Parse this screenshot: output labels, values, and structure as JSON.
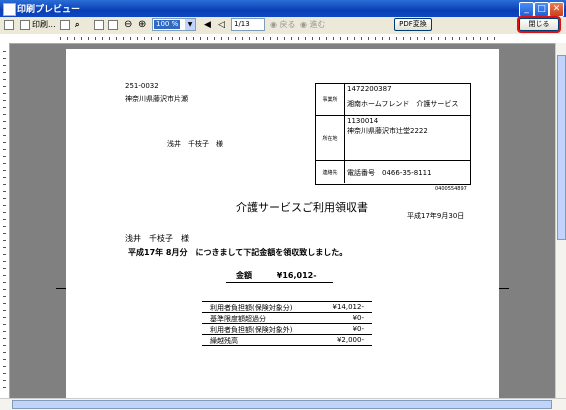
{
  "window": {
    "title": "印刷プレビュー"
  },
  "toolbar": {
    "print_label": "印刷...",
    "zoom_value": "100 %",
    "page_value": "1/13",
    "prev_label": "戻る",
    "next_label": "進む",
    "pdf_label": "PDF変換",
    "close_label": "閉じる"
  },
  "doc": {
    "postal": "251-0032",
    "address": "神奈川県藤沢市片瀬",
    "recipient": "浅井　千枝子　様",
    "office_label": "事業所",
    "office_code": "1472200387",
    "office_name": "湘南ホームフレンド　介護サービス",
    "location_label": "所在地",
    "location_postal": "1130014",
    "location_address": "神奈川県藤沢市辻堂2222",
    "contact_label": "連絡先",
    "contact_value": "電話番号　0466-35-8111",
    "doc_no": "0400554897",
    "heading": "介護サービスご利用領収書",
    "date": "平成17年9月30日",
    "customer": "浅井　千枝子　様",
    "statement": "平成17年 8月分　につきまして下記金額を領収致しました。",
    "total_label": "金額",
    "total_value": "¥16,012-",
    "rows": [
      {
        "label": "利用者負担額(保険対象分)",
        "value": "¥14,012-"
      },
      {
        "label": "基準限度額超過分",
        "value": "¥0-"
      },
      {
        "label": "利用者負担額(保険対象外)",
        "value": "¥0-"
      },
      {
        "label": "繰越残高",
        "value": "¥2,000-"
      }
    ]
  }
}
